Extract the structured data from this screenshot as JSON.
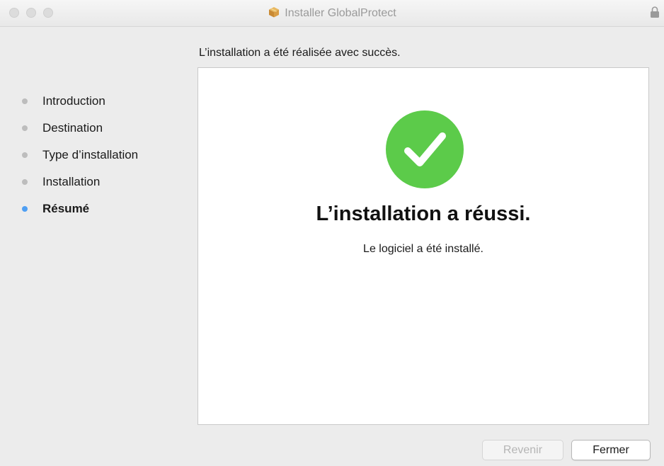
{
  "window": {
    "title": "Installer GlobalProtect",
    "title_icon": "package-icon",
    "lock_icon": "lock-icon"
  },
  "header": {
    "text": "L’installation a été réalisée avec succès."
  },
  "sidebar": {
    "items": [
      {
        "label": "Introduction",
        "active": false
      },
      {
        "label": "Destination",
        "active": false
      },
      {
        "label": "Type d’installation",
        "active": false
      },
      {
        "label": "Installation",
        "active": false
      },
      {
        "label": "Résumé",
        "active": true
      }
    ]
  },
  "main": {
    "icon": "checkmark-circle-icon",
    "title": "L’installation a réussi.",
    "subtitle": "Le logiciel a été installé."
  },
  "buttons": {
    "back_label": "Revenir",
    "back_enabled": false,
    "close_label": "Fermer"
  },
  "colors": {
    "active_step": "#4f9ff3",
    "inactive_step": "#bdbdbd",
    "success_green": "#5ccb4a"
  }
}
